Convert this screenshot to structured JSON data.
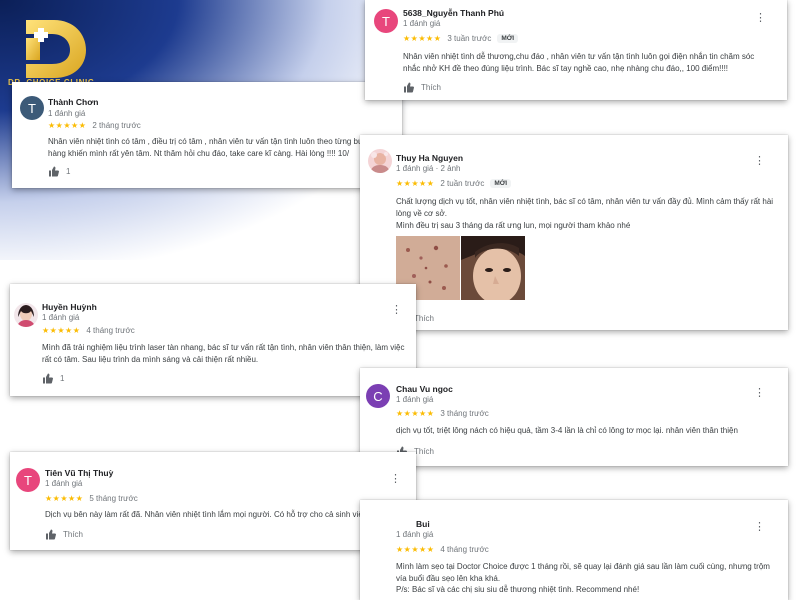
{
  "brand": {
    "logo_text": "DR. CHOICE CLINIC"
  },
  "colors": {
    "star": "#fbbc04",
    "logo_gold": "#f0c84a",
    "bg_blue": "#1d3b8f"
  },
  "reviews": [
    {
      "id": "thanh-chon",
      "name": "Thành Chơn",
      "avatar_letter": "T",
      "avatar_color": "#3c5a78",
      "meta": "1 đánh giá",
      "stars": "★★★★★",
      "time": "2 tháng trước",
      "badge": "",
      "text": "Nhân viên nhiệt tình có tâm , điều trị có tâm , nhân viên tư vấn tận tình luôn theo từng buổi khách hàng khiến mình rất yên tâm. Nt thăm hỏi chu đáo, take care kĩ càng. Hài lòng !!!! 10/",
      "likes": "1"
    },
    {
      "id": "nguyen-thanh-phu",
      "name": "5638_Nguyễn Thanh Phú",
      "avatar_letter": "T",
      "avatar_color": "#e8467c",
      "meta": "1 đánh giá",
      "stars": "★★★★★",
      "time": "3 tuần trước",
      "badge": "MỚI",
      "text": "Nhân viên nhiệt tình dễ thương,chu đáo , nhân viên tư vấn tận tình luôn gọi điện nhắn tin chăm sóc nhắc nhở KH đề theo đúng liệu trình. Bác sĩ tay nghề cao, nhẹ nhàng chu đáo,, 100 điểm!!!!",
      "likes": "Thích"
    },
    {
      "id": "thuy-ha-nguyen",
      "name": "Thuy Ha Nguyen",
      "meta": "1 đánh giá · 2 ảnh",
      "stars": "★★★★★",
      "time": "2 tuần trước",
      "badge": "MỚI",
      "text": "Chất lượng dịch vụ tốt, nhân viên nhiệt tình, bác sĩ có tâm, nhân viên tư vấn đầy đủ. Mình cảm thấy rất hài lòng về cơ sở.",
      "text2": "Mình đều trị sau 3 tháng da rất ưng lun, mọi người tham khảo nhé",
      "likes": "Thích"
    },
    {
      "id": "huyen-huynh",
      "name": "Huyền Huỳnh",
      "meta": "1 đánh giá",
      "stars": "★★★★★",
      "time": "4 tháng trước",
      "badge": "",
      "text": "Mình đã trải nghiệm liệu trình laser tàn nhang, bác sĩ tư vấn rất tận tình, nhân viên thân thiện, làm việc rất có tâm. Sau liệu trình da mình sáng và cải thiện rất nhiều.",
      "likes": "1"
    },
    {
      "id": "chau-vu-ngoc",
      "name": "Chau Vu ngoc",
      "avatar_letter": "C",
      "avatar_color": "#7b3fb3",
      "meta": "1 đánh giá",
      "stars": "★★★★★",
      "time": "3 tháng trước",
      "badge": "",
      "text": "dịch vụ tốt, triệt lông nách có hiệu quả, tầm 3-4 lần là chỉ có lông tơ mọc lại. nhân viên thân thiện",
      "likes": "Thích"
    },
    {
      "id": "tien-vu-thi-thuy",
      "name": "Tiên Vũ Thị Thuỳ",
      "avatar_letter": "T",
      "avatar_color": "#e8467c",
      "meta": "1 đánh giá",
      "stars": "★★★★★",
      "time": "5 tháng trước",
      "badge": "",
      "text": "Dịch vụ bên này làm rất đã. Nhân viên nhiệt tình lắm mọi người. Có hỗ trợ cho cả sinh viên . 😄",
      "likes": "Thích"
    },
    {
      "id": "bui",
      "name": "Bui",
      "meta": "1 đánh giá",
      "stars": "★★★★★",
      "time": "4 tháng trước",
      "badge": "",
      "text": "Mình làm sẹo tại Doctor Choice được 1 tháng rồi, sẽ quay lại đánh giá sau lần làm cuối cùng, nhưng trộm vía buổi đầu sẹo lên kha khá.",
      "text2": "P/s: Bác sĩ và các chị siu siu dễ thương nhiệt tình. Recommend nhé!"
    }
  ]
}
